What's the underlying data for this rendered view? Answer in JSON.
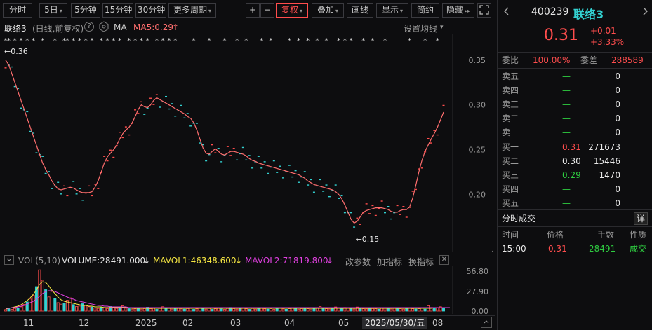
{
  "toolbar": {
    "left_tabs": [
      {
        "label": "分时"
      },
      {
        "label": "5日",
        "caret": "▾"
      },
      {
        "label": "5分钟"
      },
      {
        "label": "15分钟"
      },
      {
        "label": "30分钟"
      },
      {
        "label": "更多周期",
        "caret": "▾"
      }
    ],
    "plus": "+",
    "minus": "−",
    "right_tabs": [
      {
        "label": "复权",
        "caret": "▾",
        "active": true
      },
      {
        "label": "叠加",
        "caret": "▾"
      },
      {
        "label": "画线"
      },
      {
        "label": "显示",
        "caret": "▾"
      },
      {
        "label": "简约"
      },
      {
        "label": "隐藏",
        "caret": "▸▸"
      }
    ],
    "fullscreen_icon": "expand-icon"
  },
  "chart_info": {
    "name": "联络3",
    "mode": "(日线,前复权)",
    "help": "?",
    "ma_label": "MA",
    "ma5": "MA5:0.29",
    "ma5_arrow": "↑",
    "settings": "设置均线",
    "settings_caret": "▾"
  },
  "volume_info": {
    "title": "VOL(5,10)",
    "volume": "VOLUME:28491.000",
    "volume_arrow": "↓",
    "mavol1": "MAVOL1:46348.600",
    "mavol1_arrow": "↓",
    "mavol2": "MAVOL2:71819.800",
    "mavol2_arrow": "↓",
    "change_params": "改参数",
    "add_indicator": "加指标",
    "switch_indicator": "换指标",
    "close": "✕"
  },
  "date_axis": {
    "labels": [
      "11",
      "12",
      "2025",
      "02",
      "03",
      "04",
      "05",
      "2025/05/30/五",
      "08"
    ]
  },
  "quote": {
    "code": "400239",
    "name": "联络3",
    "price": "0.31",
    "change": "+0.01",
    "change_pct": "+3.33%",
    "weibi_label": "委比",
    "weibi_value": "100.00%",
    "weicha_label": "委差",
    "weicha_value": "288589",
    "sells": [
      {
        "label": "卖五",
        "price": "—",
        "vol": "0"
      },
      {
        "label": "卖四",
        "price": "—",
        "vol": "0"
      },
      {
        "label": "卖三",
        "price": "—",
        "vol": "0"
      },
      {
        "label": "卖二",
        "price": "—",
        "vol": "0"
      },
      {
        "label": "卖一",
        "price": "—",
        "vol": "0"
      }
    ],
    "buys": [
      {
        "label": "买一",
        "price": "0.31",
        "vol": "271673",
        "color": "red"
      },
      {
        "label": "买二",
        "price": "0.30",
        "vol": "15446",
        "color": "white"
      },
      {
        "label": "买三",
        "price": "0.29",
        "vol": "1470",
        "color": "green"
      },
      {
        "label": "买四",
        "price": "—",
        "vol": "0",
        "color": "green"
      },
      {
        "label": "买五",
        "price": "—",
        "vol": "0",
        "color": "green"
      }
    ],
    "trades_title": "分时成交",
    "trades_detail": "详",
    "trade_headers": [
      "时间",
      "价格",
      "手数",
      "性质"
    ],
    "trades": [
      {
        "time": "15:00",
        "price": "0.31",
        "volume": "28491",
        "nature": "成交"
      }
    ]
  },
  "colors": {
    "up": "#ff4d4d",
    "down": "#33d1d1",
    "ma5": "#ff6e6e",
    "mavol1": "#f5e642",
    "mavol2": "#e040e0",
    "grid": "#2a2a2e"
  },
  "chart_data": {
    "type": "line",
    "price_axis_ticks": [
      "0.35",
      "0.30",
      "0.25",
      "0.20"
    ],
    "price_ticks_values": [
      0.35,
      0.3,
      0.25,
      0.2
    ],
    "ylim": [
      0.14,
      0.375
    ],
    "max_label": "0.36",
    "min_label": "0.15",
    "max_value": 0.36,
    "min_value": 0.15,
    "ma5": [
      0.35,
      0.345,
      0.335,
      0.325,
      0.315,
      0.305,
      0.295,
      0.285,
      0.275,
      0.265,
      0.255,
      0.245,
      0.235,
      0.228,
      0.222,
      0.215,
      0.21,
      0.206,
      0.205,
      0.206,
      0.207,
      0.208,
      0.207,
      0.205,
      0.203,
      0.202,
      0.202,
      0.202,
      0.203,
      0.208,
      0.215,
      0.225,
      0.235,
      0.242,
      0.246,
      0.25,
      0.255,
      0.262,
      0.268,
      0.272,
      0.275,
      0.28,
      0.287,
      0.295,
      0.3,
      0.298,
      0.297,
      0.3,
      0.305,
      0.308,
      0.306,
      0.304,
      0.302,
      0.3,
      0.298,
      0.296,
      0.294,
      0.292,
      0.29,
      0.287,
      0.285,
      0.28,
      0.272,
      0.262,
      0.252,
      0.246,
      0.245,
      0.248,
      0.251,
      0.248,
      0.245,
      0.244,
      0.246,
      0.248,
      0.248,
      0.247,
      0.246,
      0.245,
      0.243,
      0.24,
      0.238,
      0.237,
      0.235,
      0.234,
      0.233,
      0.232,
      0.231,
      0.23,
      0.229,
      0.228,
      0.227,
      0.226,
      0.225,
      0.224,
      0.223,
      0.222,
      0.22,
      0.218,
      0.215,
      0.213,
      0.211,
      0.21,
      0.209,
      0.208,
      0.207,
      0.206,
      0.205,
      0.203,
      0.2,
      0.195,
      0.188,
      0.18,
      0.172,
      0.168,
      0.17,
      0.175,
      0.18,
      0.182,
      0.183,
      0.184,
      0.185,
      0.185,
      0.185,
      0.184,
      0.183,
      0.181,
      0.18,
      0.18,
      0.182,
      0.183,
      0.183,
      0.186,
      0.196,
      0.21,
      0.225,
      0.238,
      0.248,
      0.255,
      0.262,
      0.268,
      0.275,
      0.283,
      0.292
    ],
    "volume": [
      2.1,
      3.2,
      2.5,
      3.8,
      4.2,
      6.1,
      9.5,
      13.0,
      17.2,
      22.5,
      35.0,
      58.8,
      44.0,
      30.5,
      20.2,
      28.0,
      18.5,
      12.1,
      9.8,
      11.2,
      15.4,
      18.9,
      9.2,
      6.5,
      7.2,
      10.5,
      8.5,
      6.2,
      5.8,
      4.5,
      3.8,
      5.2,
      4.8,
      3.5,
      6.5,
      4.8,
      3.8,
      5.2,
      7.5,
      4.2,
      3.5,
      2.8,
      3.2,
      4.5,
      2.8,
      3.5,
      5.5,
      3.2,
      4.8,
      2.5,
      3.8,
      6.2,
      4.5,
      3.8,
      2.8,
      3.5,
      4.2,
      3.0,
      2.8,
      3.6,
      4.8,
      2.5,
      3.2,
      4.8,
      3.5,
      2.8,
      3.8,
      2.5,
      3.2,
      4.2,
      3.0,
      2.5,
      3.8,
      5.2,
      3.5,
      2.8,
      3.5,
      4.5,
      3.2,
      2.5,
      3.8,
      2.8,
      3.4,
      4.0,
      3.1,
      2.8,
      3.5,
      2.6,
      3.2,
      4.3,
      3.0,
      2.6,
      3.4,
      4.4,
      3.1,
      2.7,
      3.5,
      4.2,
      3.3,
      2.8,
      3.6,
      5.0,
      6.5,
      4.4,
      3.4,
      2.9,
      4.8,
      5.9,
      4.1,
      3.4,
      5.2,
      4.7,
      3.5,
      2.9,
      5.8,
      4.6,
      3.3,
      3.0,
      4.3,
      3.6,
      3.2,
      2.7,
      3.9,
      4.4,
      3.5,
      2.9,
      4.0,
      4.8,
      3.3,
      2.8,
      3.7,
      5.1,
      3.4,
      2.9,
      3.3,
      4.1,
      2.8,
      7.5,
      5.2,
      3.8,
      4.9,
      6.2,
      4.1
    ],
    "vol_axis_ticks": [
      "56.80",
      "27.90",
      "0.00"
    ],
    "vol_tick_values": [
      56.8,
      27.9,
      0.0
    ],
    "vol_ylim": [
      0,
      62
    ],
    "mavol1_line": [
      3,
      4,
      5,
      6,
      7,
      9,
      12,
      15,
      19,
      24,
      30,
      38,
      42,
      41,
      36,
      30,
      25,
      20,
      16,
      14,
      13,
      12,
      11,
      10,
      9,
      8,
      8,
      7,
      7,
      6,
      6,
      6,
      5,
      5,
      5,
      5,
      5,
      5,
      5,
      5,
      5,
      4,
      4,
      4,
      4,
      4,
      4,
      4,
      4,
      4,
      4,
      4,
      4,
      4,
      4,
      4,
      4,
      4,
      4,
      4,
      4,
      4,
      4,
      4,
      4,
      4,
      4,
      4,
      4,
      4,
      4,
      4,
      4,
      4,
      4,
      4,
      4,
      4,
      4,
      4,
      4,
      4,
      4,
      4,
      4,
      4,
      4,
      4,
      4,
      4,
      4,
      4,
      4,
      4,
      4,
      4,
      4,
      4,
      4,
      4,
      4,
      4,
      4,
      4,
      4,
      4,
      4,
      4,
      4,
      4,
      4,
      4,
      4,
      4,
      4,
      4,
      4,
      4,
      4,
      4,
      4,
      4,
      4,
      4,
      4,
      4,
      4,
      4,
      4,
      4,
      4,
      4,
      4,
      4,
      4,
      4,
      4,
      4,
      4,
      5,
      5,
      5,
      5,
      5,
      5
    ],
    "mavol2_line": [
      4,
      4,
      5,
      5,
      6,
      7,
      8,
      10,
      12,
      14,
      17,
      21,
      25,
      28,
      29,
      29,
      28,
      26,
      24,
      22,
      20,
      18,
      17,
      15,
      14,
      13,
      12,
      11,
      10,
      9,
      8,
      8,
      7,
      7,
      6,
      6,
      6,
      6,
      6,
      6,
      5,
      5,
      5,
      5,
      5,
      5,
      5,
      5,
      5,
      5,
      5,
      5,
      5,
      5,
      5,
      5,
      5,
      5,
      5,
      5,
      5,
      5,
      5,
      5,
      5,
      5,
      5,
      5,
      5,
      5,
      5,
      5,
      5,
      5,
      5,
      5,
      5,
      5,
      5,
      5,
      5,
      5,
      5,
      5,
      5,
      5,
      5,
      5,
      5,
      5,
      5,
      5,
      5,
      5,
      5,
      5,
      5,
      5,
      5,
      5,
      5,
      5,
      5,
      5,
      5,
      5,
      5,
      5,
      5,
      5,
      5,
      5,
      5,
      5,
      5,
      5,
      5,
      5,
      5,
      5,
      5,
      5,
      5,
      5,
      5,
      5,
      5,
      5,
      5,
      5,
      5,
      5,
      5,
      5,
      5,
      5,
      5,
      5,
      5,
      5,
      5,
      5,
      5,
      5,
      5
    ]
  }
}
